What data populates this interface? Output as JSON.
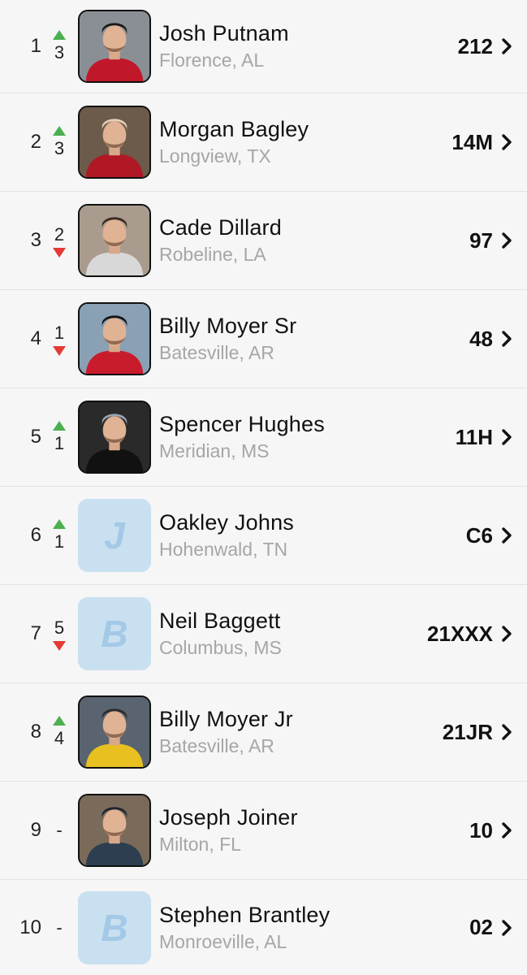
{
  "drivers": [
    {
      "position": "1",
      "change_dir": "up",
      "change": "3",
      "name": "Josh Putnam",
      "location": "Florence, AL",
      "car": "212",
      "avatar": "photo",
      "photo_bg": "#8a8f96",
      "suit": "#c0182a",
      "helmet": "#1a1a1a"
    },
    {
      "position": "2",
      "change_dir": "up",
      "change": "3",
      "name": "Morgan Bagley",
      "location": "Longview, TX",
      "car": "14M",
      "avatar": "photo",
      "photo_bg": "#6c5a4a",
      "suit": "#b01826",
      "helmet": "#e8d0b8"
    },
    {
      "position": "3",
      "change_dir": "down",
      "change": "2",
      "name": "Cade Dillard",
      "location": "Robeline, LA",
      "car": "97",
      "avatar": "photo",
      "photo_bg": "#a99c8e",
      "suit": "#d8d8d8",
      "helmet": "#3a2a20"
    },
    {
      "position": "4",
      "change_dir": "down",
      "change": "1",
      "name": "Billy Moyer Sr",
      "location": "Batesville, AR",
      "car": "48",
      "avatar": "photo",
      "photo_bg": "#8aa0b4",
      "suit": "#c81c2c",
      "helmet": "#141414"
    },
    {
      "position": "5",
      "change_dir": "up",
      "change": "1",
      "name": "Spencer Hughes",
      "location": "Meridian, MS",
      "car": "11H",
      "avatar": "photo",
      "photo_bg": "#2a2a2a",
      "suit": "#111111",
      "helmet": "#9aa6b4"
    },
    {
      "position": "6",
      "change_dir": "up",
      "change": "1",
      "name": "Oakley Johns",
      "location": "Hohenwald, TN",
      "car": "C6",
      "avatar": "letter",
      "letter": "J"
    },
    {
      "position": "7",
      "change_dir": "down",
      "change": "5",
      "name": "Neil Baggett",
      "location": "Columbus, MS",
      "car": "21XXX",
      "avatar": "letter",
      "letter": "B"
    },
    {
      "position": "8",
      "change_dir": "up",
      "change": "4",
      "name": "Billy Moyer Jr",
      "location": "Batesville, AR",
      "car": "21JR",
      "avatar": "photo",
      "photo_bg": "#5a6470",
      "suit": "#e8c020",
      "helmet": "#2a2a2a"
    },
    {
      "position": "9",
      "change_dir": "none",
      "change": "-",
      "name": "Joseph Joiner",
      "location": "Milton, FL",
      "car": "10",
      "avatar": "photo",
      "photo_bg": "#7a6a5a",
      "suit": "#2c3e50",
      "helmet": "#1c2430"
    },
    {
      "position": "10",
      "change_dir": "none",
      "change": "-",
      "name": "Stephen Brantley",
      "location": "Monroeville, AL",
      "car": "02",
      "avatar": "letter",
      "letter": "B"
    }
  ],
  "colors": {
    "up": "#4caf50",
    "down": "#e53935",
    "placeholder_bg": "#c9e0f0",
    "placeholder_letter": "#a3c9e6"
  }
}
